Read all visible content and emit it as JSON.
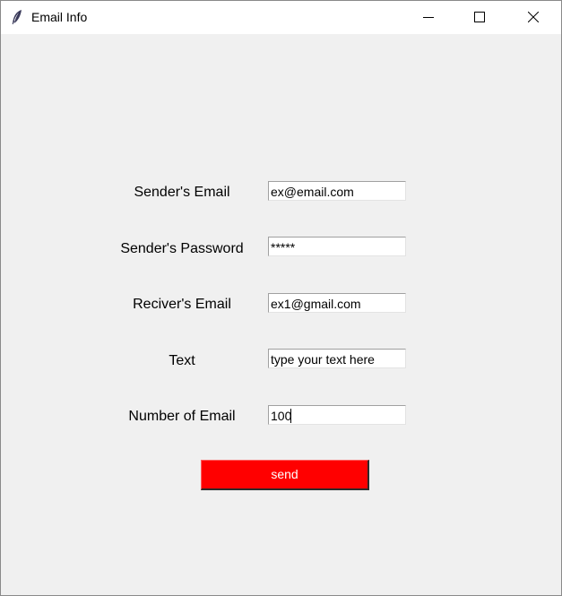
{
  "window": {
    "title": "Email Info"
  },
  "titlebar_icons": [
    "feather-icon",
    "minimize-icon",
    "maximize-icon",
    "close-icon"
  ],
  "form": {
    "sender_email": {
      "label": "Sender's Email",
      "value": "ex@email.com"
    },
    "sender_password": {
      "label": "Sender's Password",
      "value": "*****"
    },
    "receiver_email": {
      "label": "Reciver's Email",
      "value": "ex1@gmail.com"
    },
    "text": {
      "label": "Text",
      "value": "type your text here"
    },
    "number_of_email": {
      "label": "Number of Email",
      "value": "100"
    },
    "send_label": "send"
  },
  "colors": {
    "send_button": "#ff0000",
    "send_text": "#ffffff",
    "background": "#f0f0f0"
  }
}
